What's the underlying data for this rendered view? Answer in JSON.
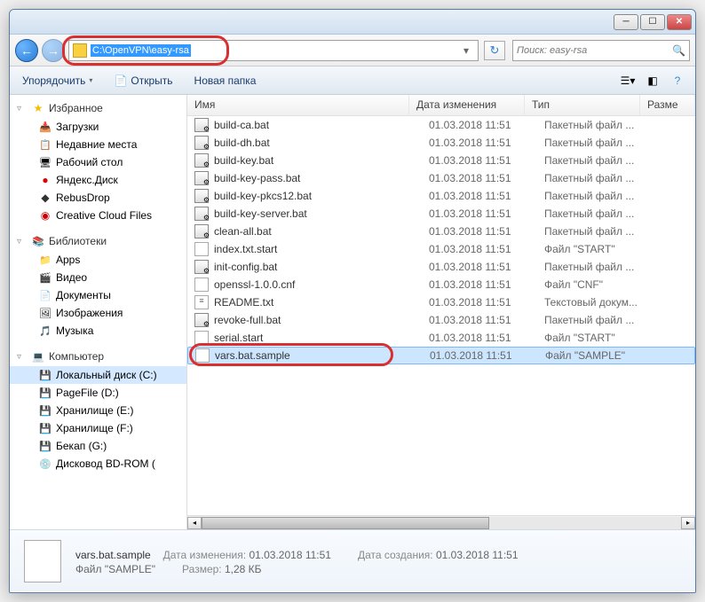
{
  "address_path": "C:\\OpenVPN\\easy-rsa",
  "search_placeholder": "Поиск: easy-rsa",
  "toolbar": {
    "organize": "Упорядочить",
    "open": "Открыть",
    "new_folder": "Новая папка"
  },
  "columns": {
    "name": "Имя",
    "date": "Дата изменения",
    "type": "Тип",
    "size": "Разме"
  },
  "sidebar": {
    "favorites": "Избранное",
    "favorites_items": [
      {
        "label": "Загрузки",
        "ico": "ico-dl"
      },
      {
        "label": "Недавние места",
        "ico": "ico-recent"
      },
      {
        "label": "Рабочий стол",
        "ico": "ico-desk"
      },
      {
        "label": "Яндекс.Диск",
        "ico": "ico-yandex"
      },
      {
        "label": "RebusDrop",
        "ico": "ico-rebus"
      },
      {
        "label": "Creative Cloud Files",
        "ico": "ico-cc"
      }
    ],
    "libraries": "Библиотеки",
    "libraries_items": [
      {
        "label": "Apps",
        "ico": "ico-apps"
      },
      {
        "label": "Видео",
        "ico": "ico-video"
      },
      {
        "label": "Документы",
        "ico": "ico-docs"
      },
      {
        "label": "Изображения",
        "ico": "ico-img"
      },
      {
        "label": "Музыка",
        "ico": "ico-music"
      }
    ],
    "computer": "Компьютер",
    "computer_items": [
      {
        "label": "Локальный диск (C:)",
        "ico": "ico-disk",
        "selected": true
      },
      {
        "label": "PageFile (D:)",
        "ico": "ico-disk"
      },
      {
        "label": "Хранилище (E:)",
        "ico": "ico-disk"
      },
      {
        "label": "Хранилище (F:)",
        "ico": "ico-disk"
      },
      {
        "label": "Бекап (G:)",
        "ico": "ico-disk"
      },
      {
        "label": "Дисковод BD-ROM (",
        "ico": "ico-cd"
      }
    ]
  },
  "files": [
    {
      "name": "build-ca.bat",
      "date": "01.03.2018 11:51",
      "type": "Пакетный файл ...",
      "icon": "fi-bat"
    },
    {
      "name": "build-dh.bat",
      "date": "01.03.2018 11:51",
      "type": "Пакетный файл ...",
      "icon": "fi-bat"
    },
    {
      "name": "build-key.bat",
      "date": "01.03.2018 11:51",
      "type": "Пакетный файл ...",
      "icon": "fi-bat"
    },
    {
      "name": "build-key-pass.bat",
      "date": "01.03.2018 11:51",
      "type": "Пакетный файл ...",
      "icon": "fi-bat"
    },
    {
      "name": "build-key-pkcs12.bat",
      "date": "01.03.2018 11:51",
      "type": "Пакетный файл ...",
      "icon": "fi-bat"
    },
    {
      "name": "build-key-server.bat",
      "date": "01.03.2018 11:51",
      "type": "Пакетный файл ...",
      "icon": "fi-bat"
    },
    {
      "name": "clean-all.bat",
      "date": "01.03.2018 11:51",
      "type": "Пакетный файл ...",
      "icon": "fi-bat"
    },
    {
      "name": "index.txt.start",
      "date": "01.03.2018 11:51",
      "type": "Файл \"START\"",
      "icon": "fi-file"
    },
    {
      "name": "init-config.bat",
      "date": "01.03.2018 11:51",
      "type": "Пакетный файл ...",
      "icon": "fi-bat"
    },
    {
      "name": "openssl-1.0.0.cnf",
      "date": "01.03.2018 11:51",
      "type": "Файл \"CNF\"",
      "icon": "fi-file"
    },
    {
      "name": "README.txt",
      "date": "01.03.2018 11:51",
      "type": "Текстовый докум...",
      "icon": "fi-txt"
    },
    {
      "name": "revoke-full.bat",
      "date": "01.03.2018 11:51",
      "type": "Пакетный файл ...",
      "icon": "fi-bat"
    },
    {
      "name": "serial.start",
      "date": "01.03.2018 11:51",
      "type": "Файл \"START\"",
      "icon": "fi-file"
    },
    {
      "name": "vars.bat.sample",
      "date": "01.03.2018 11:51",
      "type": "Файл \"SAMPLE\"",
      "icon": "fi-file",
      "selected": true
    }
  ],
  "details": {
    "filename": "vars.bat.sample",
    "type_label": "Файл \"SAMPLE\"",
    "mod_label": "Дата изменения:",
    "mod_value": "01.03.2018 11:51",
    "size_label": "Размер:",
    "size_value": "1,28 КБ",
    "created_label": "Дата создания:",
    "created_value": "01.03.2018 11:51"
  }
}
